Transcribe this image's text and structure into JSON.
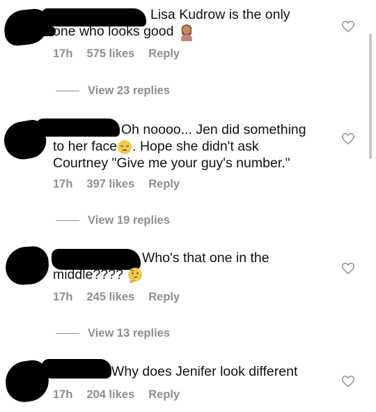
{
  "comments": [
    {
      "text_1": "Lisa Kudrow is the only",
      "text_2": "one who looks good",
      "emoji": "person-gesturing-no-emoji",
      "time": "17h",
      "likes": "575 likes",
      "reply": "Reply",
      "view_replies": "View 23 replies"
    },
    {
      "text_1": "Oh noooo... Jen did something",
      "text_2a": "to her face",
      "emoji": "pensive-face-emoji",
      "text_2b": ". Hope she didn't ask",
      "text_3": "Courtney \"Give me your guy's number.\"",
      "time": "17h",
      "likes": "397 likes",
      "reply": "Reply",
      "view_replies": "View 19 replies"
    },
    {
      "text_1": "Who's that one in the",
      "text_2": "middle????",
      "emoji": "thinking-face-emoji",
      "time": "17h",
      "likes": "245 likes",
      "reply": "Reply",
      "view_replies": "View 13 replies"
    },
    {
      "text_1": "Why does Jenifer look different",
      "time": "17h",
      "likes": "204 likes",
      "reply": "Reply"
    }
  ],
  "icons": {
    "like": "heart-outline-icon"
  },
  "colors": {
    "text": "#111111",
    "meta": "#8e8e8e",
    "redaction": "#000000"
  }
}
